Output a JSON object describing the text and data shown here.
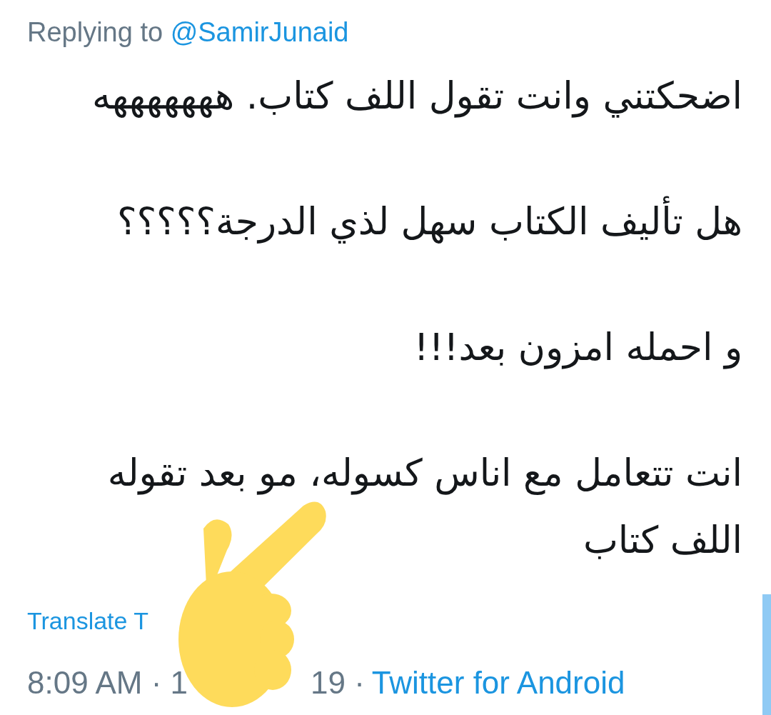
{
  "reply_to": {
    "label": "Replying to",
    "handle": "@SamirJunaid"
  },
  "tweet": {
    "paragraphs": [
      "اضحكتني وانت تقول اللف كتاب. هههههههه",
      "هل تأليف الكتاب سهل لذي الدرجة؟؟؟؟؟",
      "و احمله امزون بعد!!!",
      "انت تتعامل مع اناس كسوله، مو بعد تقوله اللف كتاب"
    ]
  },
  "translate": {
    "label": "Translate T"
  },
  "meta": {
    "time": "8:09 AM · 1",
    "date_end": "19 ·",
    "source": "Twitter for Android"
  }
}
